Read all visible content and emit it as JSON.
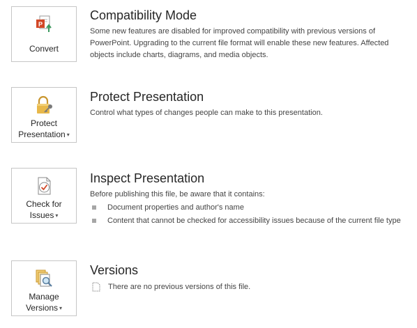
{
  "compatibility": {
    "tile_label": "Convert",
    "icon": "convert-powerpoint-icon",
    "heading": "Compatibility Mode",
    "description": "Some new features are disabled for improved compatibility with previous versions of PowerPoint. Upgrading to the current file format will enable these new features. Affected objects include charts, diagrams, and media objects."
  },
  "protect": {
    "tile_label_line1": "Protect",
    "tile_label_line2": "Presentation",
    "icon": "lock-key-icon",
    "heading": "Protect Presentation",
    "description": "Control what types of changes people can make to this presentation."
  },
  "inspect": {
    "tile_label_line1": "Check for",
    "tile_label_line2": "Issues",
    "icon": "check-document-icon",
    "heading": "Inspect Presentation",
    "description": "Before publishing this file, be aware that it contains:",
    "items": [
      "Document properties and author's name",
      "Content that cannot be checked for accessibility issues because of the current file type"
    ]
  },
  "versions": {
    "tile_label_line1": "Manage",
    "tile_label_line2": "Versions",
    "icon": "manage-versions-icon",
    "heading": "Versions",
    "description": "There are no previous versions of this file."
  },
  "colors": {
    "powerpoint_red": "#d24726",
    "lock_gold": "#e8b84a",
    "accent_green": "#3c9a5f",
    "border": "#c6c6c6"
  }
}
